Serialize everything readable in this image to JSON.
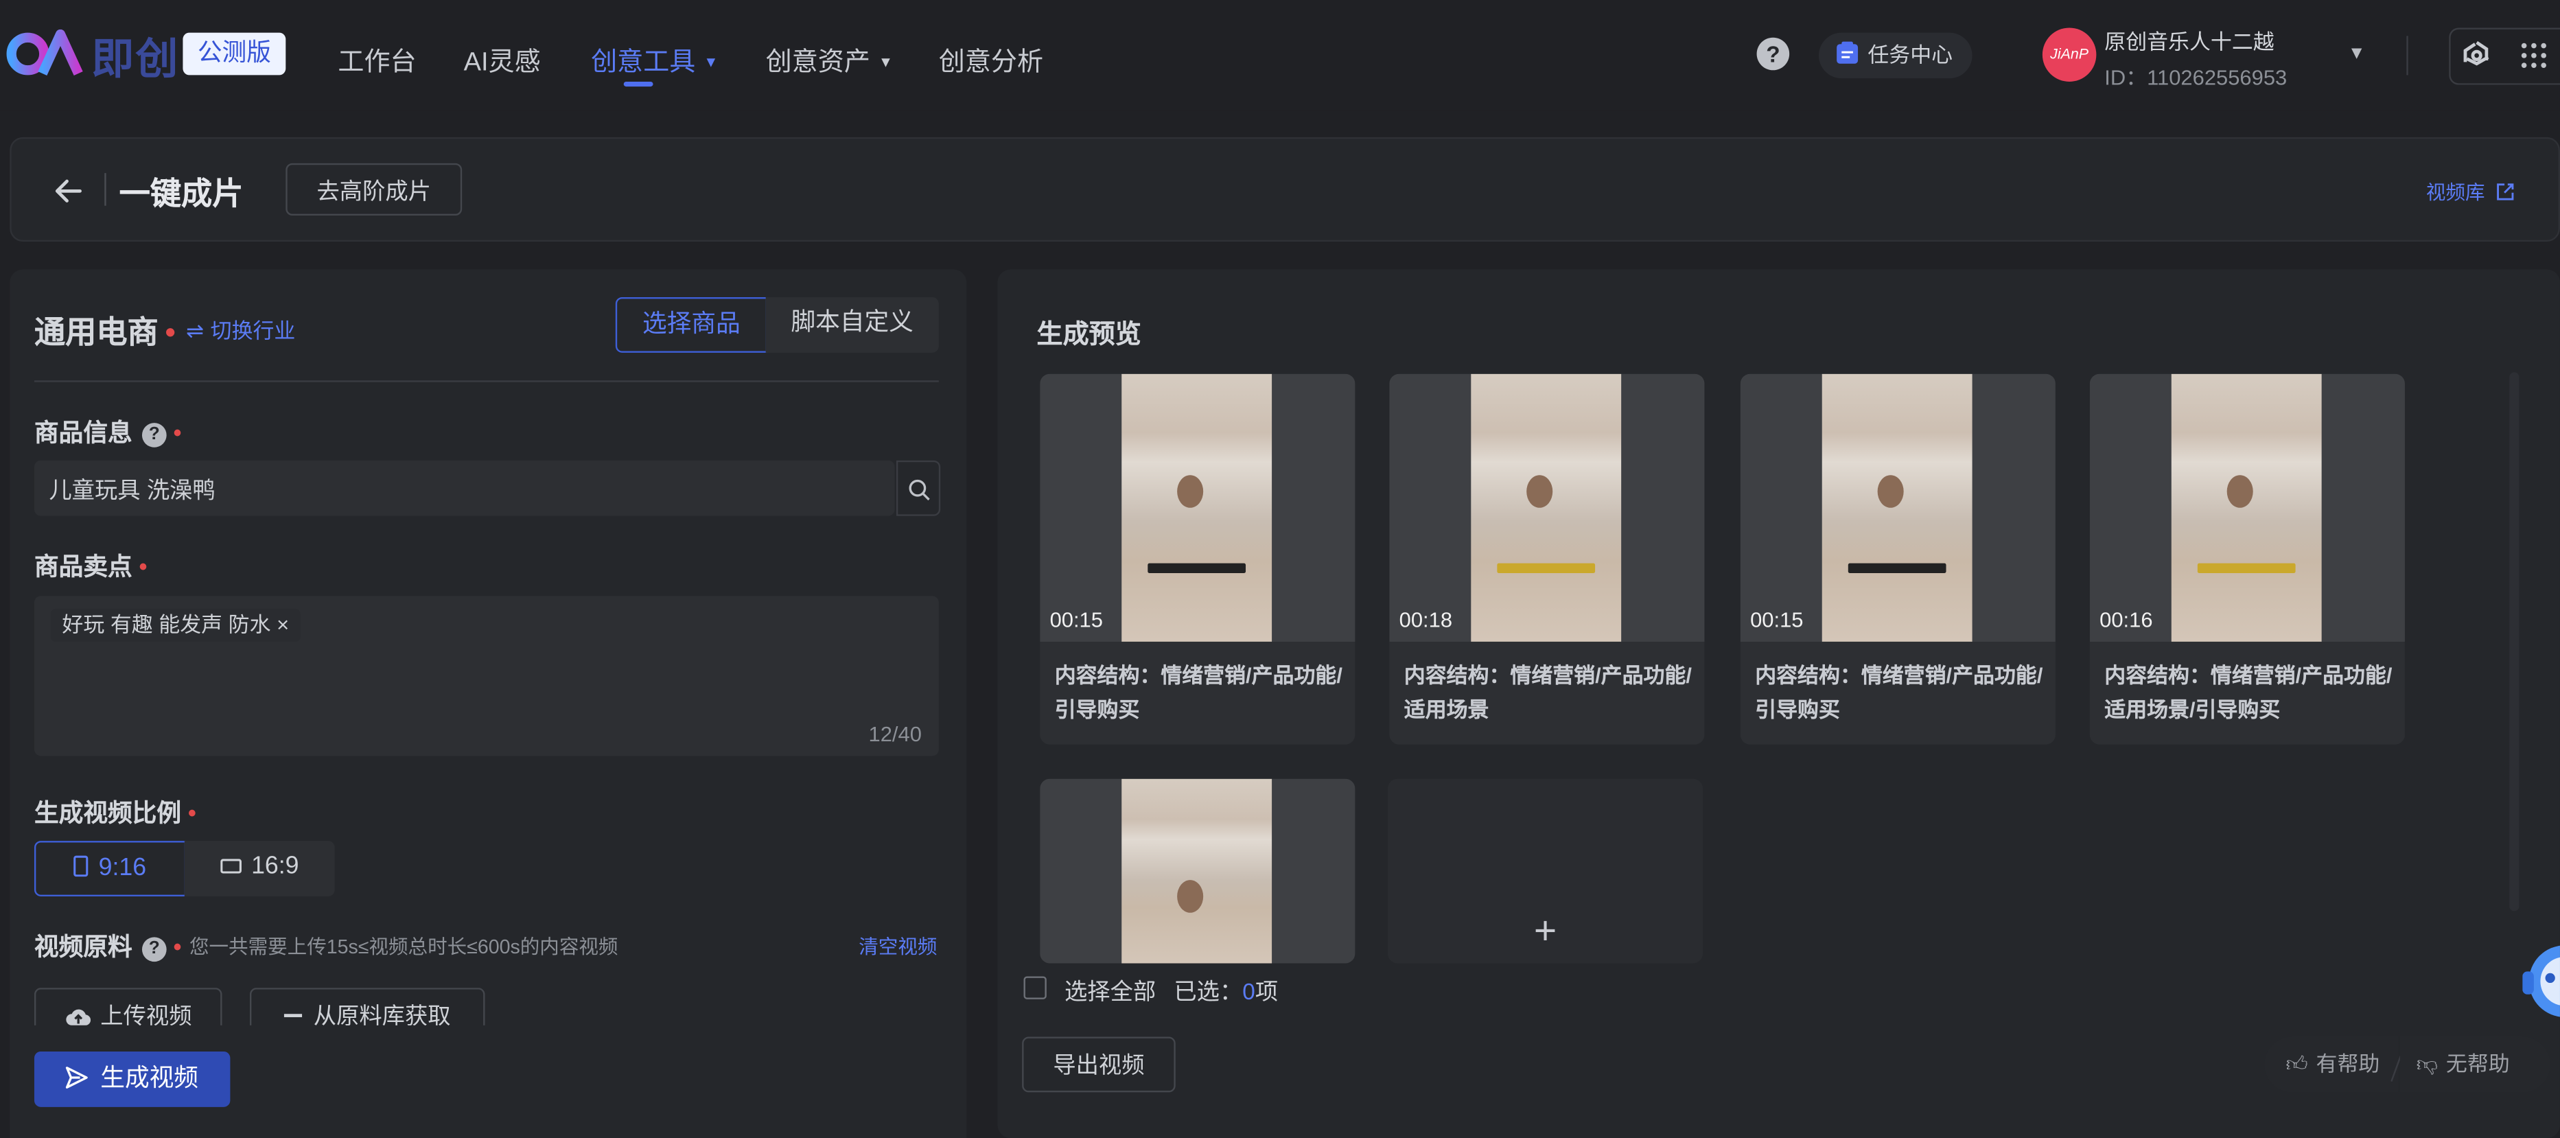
{
  "topbar": {
    "logo_text": "即创",
    "beta_label": "公测版",
    "nav": [
      {
        "label": "工作台"
      },
      {
        "label": "AI灵感"
      },
      {
        "label": "创意工具",
        "active": true
      },
      {
        "label": "创意资产"
      },
      {
        "label": "创意分析"
      }
    ],
    "help_glyph": "?",
    "task_center": "任务中心",
    "user": {
      "name": "原创音乐人十二越",
      "id": "ID：110262556953",
      "avatar_text": "JiAnP"
    }
  },
  "title_bar": {
    "title": "一键成片",
    "advanced_button": "去高阶成片",
    "video_library": "视频库"
  },
  "left_panel": {
    "industry": "通用电商",
    "switch_industry": "切换行业",
    "tabs": [
      {
        "label": "选择商品",
        "active": true
      },
      {
        "label": "脚本自定义",
        "active": false
      }
    ],
    "product_info": {
      "label": "商品信息",
      "value": "儿童玩具 洗澡鸭"
    },
    "selling_points": {
      "label": "商品卖点",
      "tag": "好玩 有趣 能发声 防水",
      "tag_close": "×",
      "counter": "12/40"
    },
    "ratio": {
      "label": "生成视频比例",
      "options": [
        {
          "label": "9:16",
          "active": true
        },
        {
          "label": "16:9",
          "active": false
        }
      ]
    },
    "material": {
      "label": "视频原料",
      "hint": "您一共需要上传15s≤视频总时长≤600s的内容视频",
      "clear": "清空视频",
      "upload": "上传视频",
      "from_library": "从原料库获取"
    },
    "generate_button": "生成视频"
  },
  "right_panel": {
    "title": "生成预览",
    "videos": [
      {
        "duration": "00:15",
        "desc": "内容结构：情绪营销/产品功能/引导购买",
        "caption_color": "#222222"
      },
      {
        "duration": "00:18",
        "desc": "内容结构：情绪营销/产品功能/适用场景",
        "caption_color": "#caa82c"
      },
      {
        "duration": "00:15",
        "desc": "内容结构：情绪营销/产品功能/引导购买",
        "caption_color": "#222222"
      },
      {
        "duration": "00:16",
        "desc": "内容结构：情绪营销/产品功能/适用场景/引导购买",
        "caption_color": "#caa82c"
      }
    ],
    "add_glyph": "+",
    "select_all": "选择全部",
    "selected_prefix": "已选：",
    "selected_count": "0",
    "selected_suffix": "项",
    "export_button": "导出视频"
  },
  "feedback": {
    "helpful": "有帮助",
    "not_helpful": "无帮助"
  },
  "colors": {
    "accent": "#4f6fef",
    "primary_button": "#2f4bb4",
    "required": "#e34a4a",
    "background": "#202125",
    "panel": "#25272b"
  },
  "icons": [
    "logo-icon",
    "dropdown-caret-icon",
    "help-icon",
    "task-center-icon",
    "app-switch-icon",
    "grid-apps-icon",
    "back-arrow-icon",
    "external-link-icon",
    "swap-icon",
    "search-icon",
    "phone-portrait-icon",
    "landscape-icon",
    "upload-cloud-icon",
    "minus-icon",
    "send-icon",
    "plus-icon",
    "thumb-up-icon",
    "thumb-down-icon",
    "assistant-avatar-icon"
  ]
}
